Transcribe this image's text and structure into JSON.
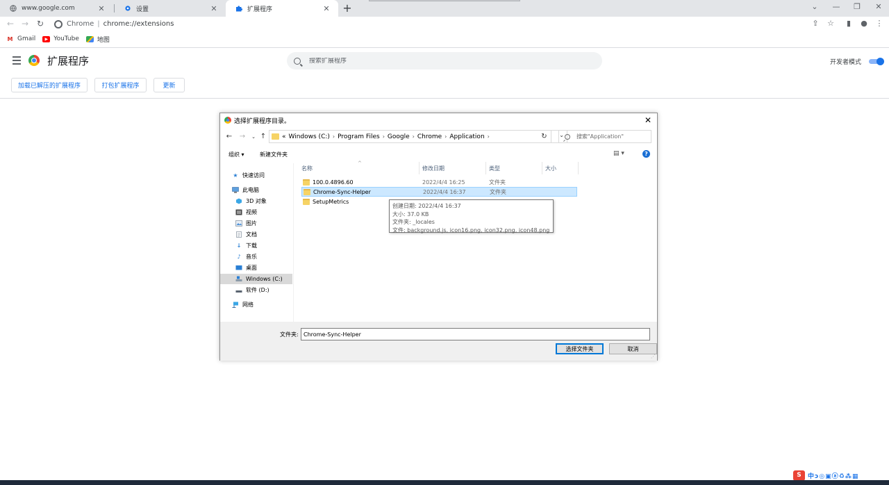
{
  "tabs": [
    {
      "title": "www.google.com",
      "icon": "globe-icon",
      "active": false
    },
    {
      "title": "设置",
      "icon": "gear-icon",
      "active": false
    },
    {
      "title": "扩展程序",
      "icon": "puzzle-icon",
      "active": true
    }
  ],
  "address": {
    "scheme": "Chrome",
    "divider": "|",
    "url": "chrome://extensions"
  },
  "bookmarks": [
    {
      "label": "Gmail",
      "icon": "gmail-icon"
    },
    {
      "label": "YouTube",
      "icon": "youtube-icon"
    },
    {
      "label": "地图",
      "icon": "maps-icon"
    }
  ],
  "page": {
    "title": "扩展程序",
    "search_placeholder": "搜索扩展程序",
    "dev_mode_label": "开发者模式",
    "dev_mode_on": true,
    "buttons": {
      "load_unpacked": "加载已解压的扩展程序",
      "pack": "打包扩展程序",
      "update": "更新"
    }
  },
  "dialog": {
    "title": "选择扩展程序目录。",
    "path_prefix": "«",
    "breadcrumb": [
      "Windows (C:)",
      "Program Files",
      "Google",
      "Chrome",
      "Application"
    ],
    "search_placeholder": "搜索\"Application\"",
    "commands": {
      "organize": "组织 ▾",
      "new_folder": "新建文件夹"
    },
    "sidebar": [
      {
        "label": "快速访问",
        "icon": "star-icon"
      },
      {
        "label": "此电脑",
        "icon": "computer-icon"
      },
      {
        "label": "3D 对象",
        "icon": "cube-icon"
      },
      {
        "label": "视频",
        "icon": "video-icon"
      },
      {
        "label": "图片",
        "icon": "picture-icon"
      },
      {
        "label": "文档",
        "icon": "document-icon"
      },
      {
        "label": "下载",
        "icon": "download-icon"
      },
      {
        "label": "音乐",
        "icon": "music-icon"
      },
      {
        "label": "桌面",
        "icon": "desktop-icon"
      },
      {
        "label": "Windows (C:)",
        "icon": "drive-icon"
      },
      {
        "label": "软件 (D:)",
        "icon": "drive-icon"
      },
      {
        "label": "网络",
        "icon": "network-icon"
      }
    ],
    "columns": {
      "name": "名称",
      "modified": "修改日期",
      "type": "类型",
      "size": "大小"
    },
    "files": [
      {
        "name": "100.0.4896.60",
        "modified": "2022/4/4 16:25",
        "type": "文件夹"
      },
      {
        "name": "Chrome-Sync-Helper",
        "modified": "2022/4/4 16:37",
        "type": "文件夹"
      },
      {
        "name": "SetupMetrics",
        "modified": "",
        "type": ""
      }
    ],
    "tooltip": [
      "创建日期: 2022/4/4 16:37",
      "大小: 37.0 KB",
      "文件夹: _locales",
      "文件: background.js, icon16.png, icon32.png, icon48.png, ..."
    ],
    "folder_label": "文件夹:",
    "folder_value": "Chrome-Sync-Helper",
    "select_button": "选择文件夹",
    "cancel_button": "取消"
  },
  "ime": {
    "logo": "S",
    "text": "中ↄ◎▣ⓐ♻⁂▦"
  }
}
